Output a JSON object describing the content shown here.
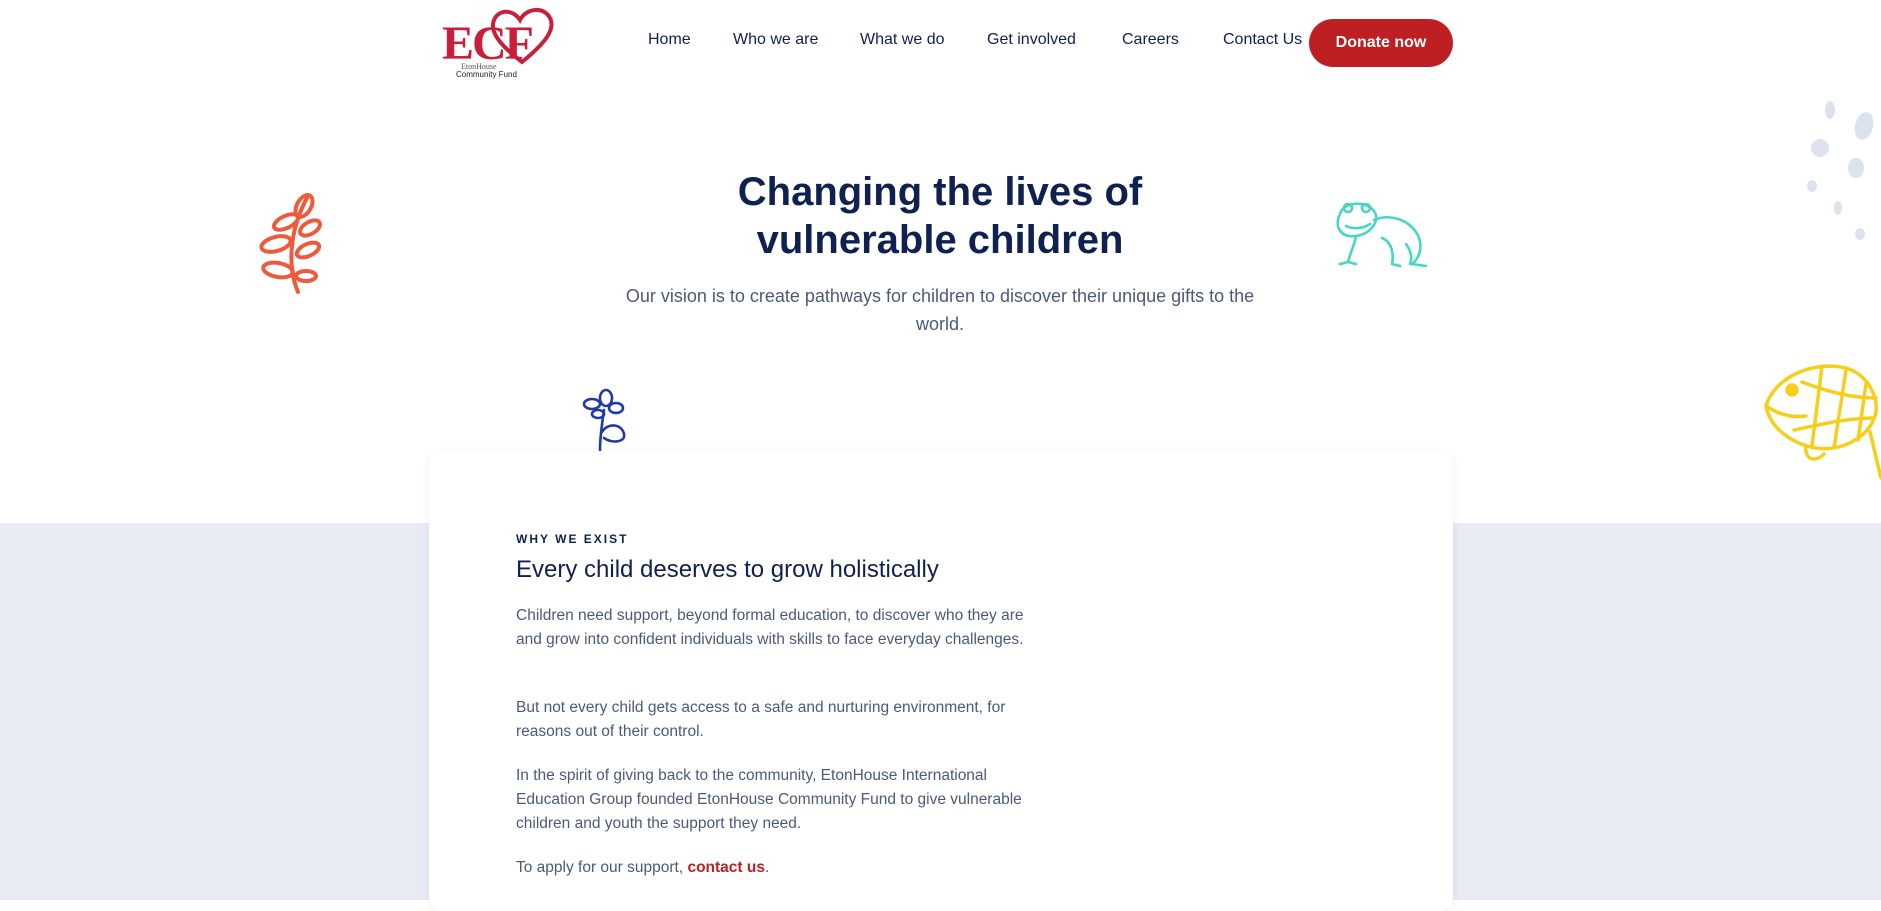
{
  "brand": {
    "logo_text": "ECF",
    "logo_sub1": "EtonHouse",
    "logo_sub2": "Community Fund",
    "accent": "#bd1f23",
    "navy": "#0f2150"
  },
  "nav": {
    "items": [
      {
        "label": "Home"
      },
      {
        "label": "Who we are"
      },
      {
        "label": "What we do"
      },
      {
        "label": "Get involved"
      },
      {
        "label": "Careers"
      },
      {
        "label": "Contact Us"
      }
    ],
    "donate_label": "Donate now"
  },
  "hero": {
    "title_line1": "Changing the lives of",
    "title_line2": "vulnerable children",
    "subtitle": "Our vision is to create pathways for children to discover their unique gifts to the world."
  },
  "why": {
    "eyebrow": "WHY WE EXIST",
    "title": "Every child deserves to grow holistically",
    "p1": "Children need support, beyond formal education, to discover who they are and grow into confident individuals with skills to face everyday challenges.",
    "p2": "But not every child gets access to a safe and nurturing environment, for reasons out of their control.",
    "p3": "In the spirit of giving back to the community, EtonHouse International Education Group founded EtonHouse Community Fund to give vulnerable children and youth the support they need.",
    "p4_prefix": "To apply for our support, ",
    "p4_link": "contact us",
    "p4_suffix": "."
  },
  "decorations": [
    "leaf-doodle-icon",
    "frog-doodle-icon",
    "flower-doodle-icon",
    "fish-doodle-icon",
    "dots-doodle-icon"
  ]
}
